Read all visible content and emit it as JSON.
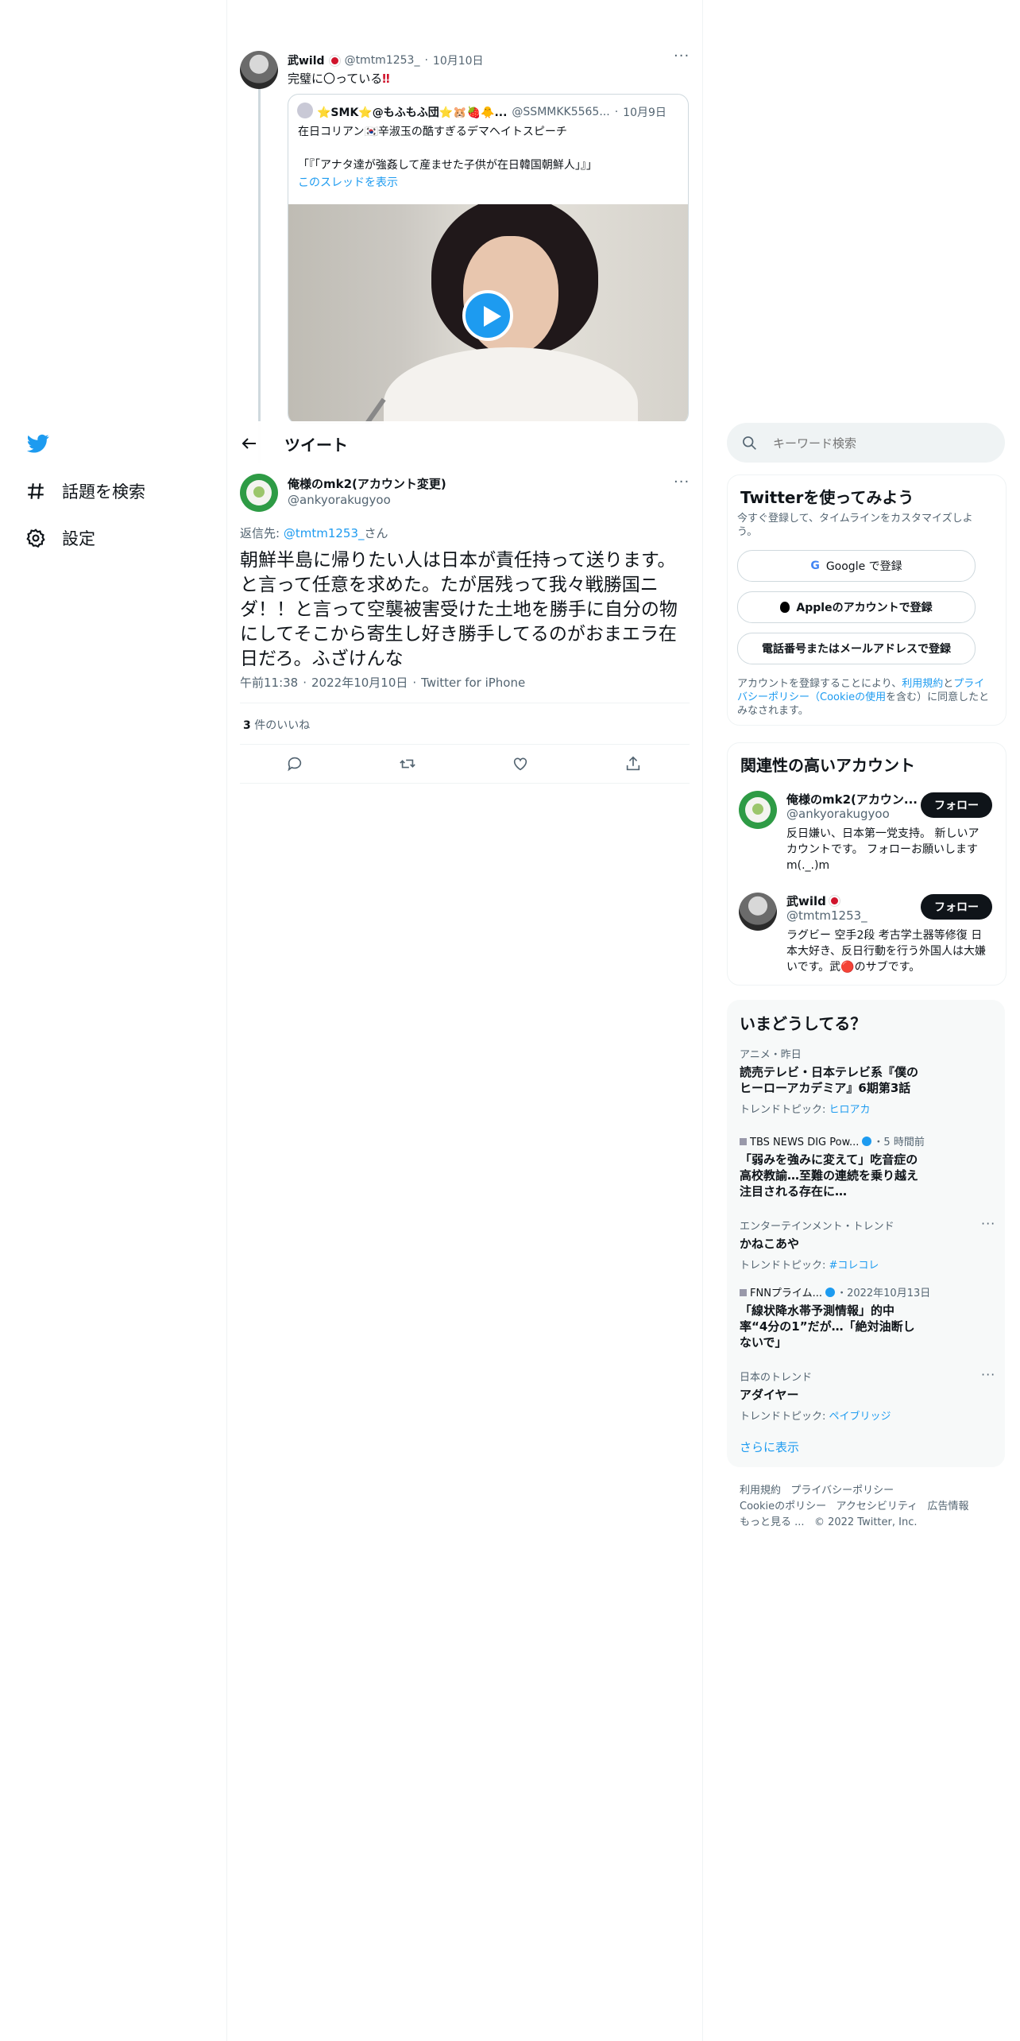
{
  "nav": {
    "logo": "twitter-bird",
    "items": [
      {
        "label": "話題を検索",
        "icon": "hashtag-icon"
      },
      {
        "label": "設定",
        "icon": "gear-icon"
      }
    ]
  },
  "parent_tweet": {
    "name": "武wild",
    "handle": "@tmtm1253_",
    "date": "10月10日",
    "text": "完璧に〇っている",
    "emoji": "‼",
    "quoted": {
      "name": "⭐SMK⭐@もふもふ団⭐🐹🍓🐥...",
      "handle": "@SSMMKK5565...",
      "date": "10月9日",
      "line1": "在日コリアン🇰🇷辛淑玉の酷すぎるデマヘイトスピーチ",
      "line2": "「『「アナタ達が強姦して産ませた子供が在日韓国朝鮮人」』」",
      "show_thread": "このスレッドを表示"
    }
  },
  "header": {
    "title": "ツイート"
  },
  "tweet": {
    "name": "俺様のmk2(アカウント変更)",
    "handle": "@ankyorakugyoo",
    "reply_prefix": "返信先: ",
    "reply_to": "@tmtm1253_",
    "reply_suffix": "さん",
    "text": "朝鮮半島に帰りたい人は日本が責任持って送ります。と言って任意を求めた。たが居残って我々戦勝国ニダ！！と言って空襲被害受けた土地を勝手に自分の物にしてそこから寄生し好き勝手してるのがおまエラ在日だろ。ふざけんな",
    "time": "午前11:38",
    "date": "2022年10月10日",
    "client": "Twitter for iPhone",
    "likes_count": "3",
    "likes_label": " 件のいいね"
  },
  "sidebar": {
    "search_placeholder": "キーワード検索",
    "signup": {
      "title": "Twitterを使ってみよう",
      "subtitle": "今すぐ登録して、タイムラインをカスタマイズしよう。",
      "google": "Google で登録",
      "apple": "Appleのアカウントで登録",
      "phone": "電話番号またはメールアドレスで登録",
      "terms_1": "アカウントを登録することにより、",
      "terms_link1": "利用規約",
      "terms_2": "と",
      "terms_link2": "プライバシーポリシー（Cookieの使用",
      "terms_3": "を含む）に同意したとみなされます。"
    },
    "related": {
      "title": "関連性の高いアカウント",
      "accounts": [
        {
          "name": "俺様のmk2(アカウン...",
          "handle": "@ankyorakugyoo",
          "bio": "反日嫌い、日本第一党支持。 新しいアカウントです。 フォローお願いしますm(._.)m",
          "follow": "フォロー"
        },
        {
          "name": "武wild",
          "handle": "@tmtm1253_",
          "bio": "ラグビー 空手2段 考古学土器等修復 日本大好き、反日行動を行う外国人は大嫌いです。武🔴のサブです。",
          "follow": "フォロー"
        }
      ]
    },
    "trends": {
      "title": "いまどうしてる？",
      "items": [
        {
          "category": "アニメ・昨日",
          "title": "読売テレビ・日本テレビ系『僕のヒーローアカデミア』6期第3話",
          "topic_label": "トレンドトピック: ",
          "topic": "ヒロアカ"
        },
        {
          "category": "TBS NEWS DIG Pow...",
          "extra": "・5 時間前",
          "title": "「弱みを強みに変えて」吃音症の高校教諭…至難の連続を乗り越え注目される存在に…"
        },
        {
          "category": "エンターテインメント・トレンド",
          "title": "かねこあや",
          "topic_label": "トレンドトピック: ",
          "topic": "#コレコレ"
        },
        {
          "category": "FNNプライム...",
          "extra": "・2022年10月13日",
          "title": "「線状降水帯予測情報」的中率“4分の1”だが…「絶対油断しないで」"
        },
        {
          "category": "日本のトレンド",
          "title": "アダイヤー",
          "topic_label": "トレンドトピック: ",
          "topic": "ペイブリッジ"
        }
      ],
      "more": "さらに表示"
    },
    "footer": {
      "line1": [
        "利用規約",
        "プライバシーポリシー"
      ],
      "line2": [
        "Cookieのポリシー",
        "アクセシビリティ",
        "広告情報"
      ],
      "more": "もっと見る ...",
      "copyright": "© 2022 Twitter, Inc."
    }
  },
  "colors": {
    "accent": "#1d9bf0",
    "text": "#0f1419",
    "secondary": "#536471",
    "border": "#eff3f4"
  }
}
